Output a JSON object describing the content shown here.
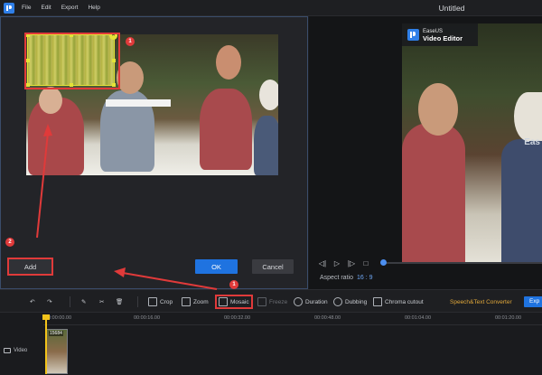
{
  "app": {
    "window_title": "Untitled",
    "menu": [
      "File",
      "Edit",
      "Export",
      "Help"
    ]
  },
  "dialog": {
    "add_label": "Add",
    "ok_label": "OK",
    "cancel_label": "Cancel",
    "mosaic_close_glyph": "×",
    "annotations": [
      "1",
      "2",
      "1"
    ]
  },
  "preview": {
    "watermark_brand": "EaseUS",
    "watermark_product": "Video Editor",
    "overlay_text": "Eas",
    "aspect_label": "Aspect ratio",
    "aspect_value": "16 : 9"
  },
  "toolbar": {
    "crop": "Crop",
    "zoom": "Zoom",
    "mosaic": "Mosaic",
    "freeze": "Freeze",
    "duration": "Duration",
    "dubbing": "Dubbing",
    "chroma": "Chroma cutout",
    "speech": "Speech&Text Converter",
    "export": "Exp"
  },
  "timeline": {
    "ticks": [
      "00:00:00.00",
      "00:00:16.00",
      "00:00:32.00",
      "00:00:48.00",
      "00:01:04.00",
      "00:01:20.00"
    ],
    "track_label": "Video",
    "clip_label": "15684"
  },
  "colors": {
    "accent": "#1f73e0",
    "annotation_red": "#e03a3a",
    "mosaic_yellow": "#e4e237",
    "speech_orange": "#e1a83a"
  }
}
